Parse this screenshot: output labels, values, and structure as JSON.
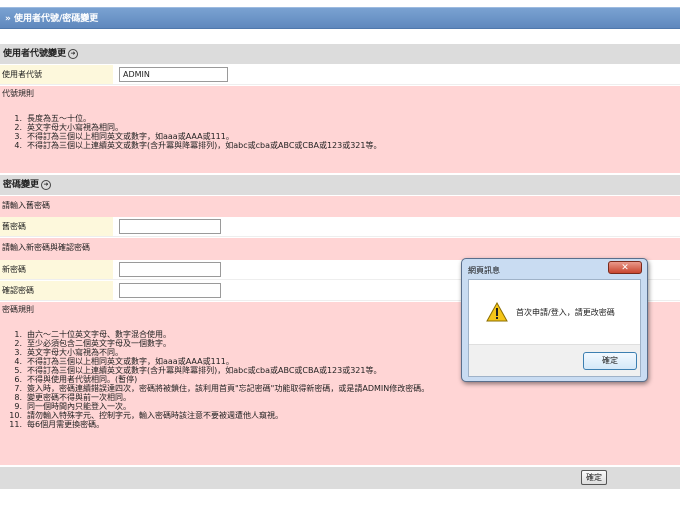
{
  "header": {
    "title": "» 使用者代號/密碼變更"
  },
  "section_userid": {
    "heading": "使用者代號變更",
    "field_label": "使用者代號",
    "field_value": "ADMIN",
    "rules_title": "代號規則",
    "rules": [
      {
        "n": "1.",
        "text": "長度為五～十位。"
      },
      {
        "n": "2.",
        "text": "英文字母大小寫視為相同。"
      },
      {
        "n": "3.",
        "text": "不得訂為三個以上相同英文或數字，如aaa或AAA或111。"
      },
      {
        "n": "4.",
        "text": "不得訂為三個以上連續英文或數字(含升冪與降冪排列)，如abc或cba或ABC或CBA或123或321等。"
      }
    ]
  },
  "section_password": {
    "heading": "密碼變更",
    "old_prompt": "請輸入舊密碼",
    "old_label": "舊密碼",
    "new_prompt": "請輸入新密碼與確認密碼",
    "new_label": "新密碼",
    "confirm_label": "確認密碼",
    "rules_title": "密碼規則",
    "rules": [
      {
        "n": "1.",
        "text": "由六～二十位英文字母、數字混合使用。"
      },
      {
        "n": "2.",
        "text": "至少必須包含二個英文字母及一個數字。"
      },
      {
        "n": "3.",
        "text": "英文字母大小寫視為不同。"
      },
      {
        "n": "4.",
        "text": "不得訂為三個以上相同英文或數字，如aaa或AAA或111。"
      },
      {
        "n": "5.",
        "text": "不得訂為三個以上連續英文或數字(含升冪與降冪排列)，如abc或cba或ABC或CBA或123或321等。"
      },
      {
        "n": "6.",
        "text": "不得與使用者代號相同。(暫停)"
      },
      {
        "n": "7.",
        "text": "簽入時，密碼連續錯誤達四次，密碼將被鎖住，該利用首頁\"忘記密碼\"功能取得新密碼，或是請ADMIN修改密碼。"
      },
      {
        "n": "8.",
        "text": "變更密碼不得與前一次相同。"
      },
      {
        "n": "9.",
        "text": "同一個時間內只能登入一次。"
      },
      {
        "n": "10.",
        "text": "請勿輸入特殊字元、控制字元，輸入密碼時該注意不要被週遭他人窺視。"
      },
      {
        "n": "11.",
        "text": "每6個月需更換密碼。"
      }
    ]
  },
  "footer": {
    "ok_label": "確定"
  },
  "dialog": {
    "title": "網頁訊息",
    "close_label": "✕",
    "message": "首次申請/登入，請更改密碼",
    "ok_label": "確定",
    "icon": "warning-icon"
  }
}
